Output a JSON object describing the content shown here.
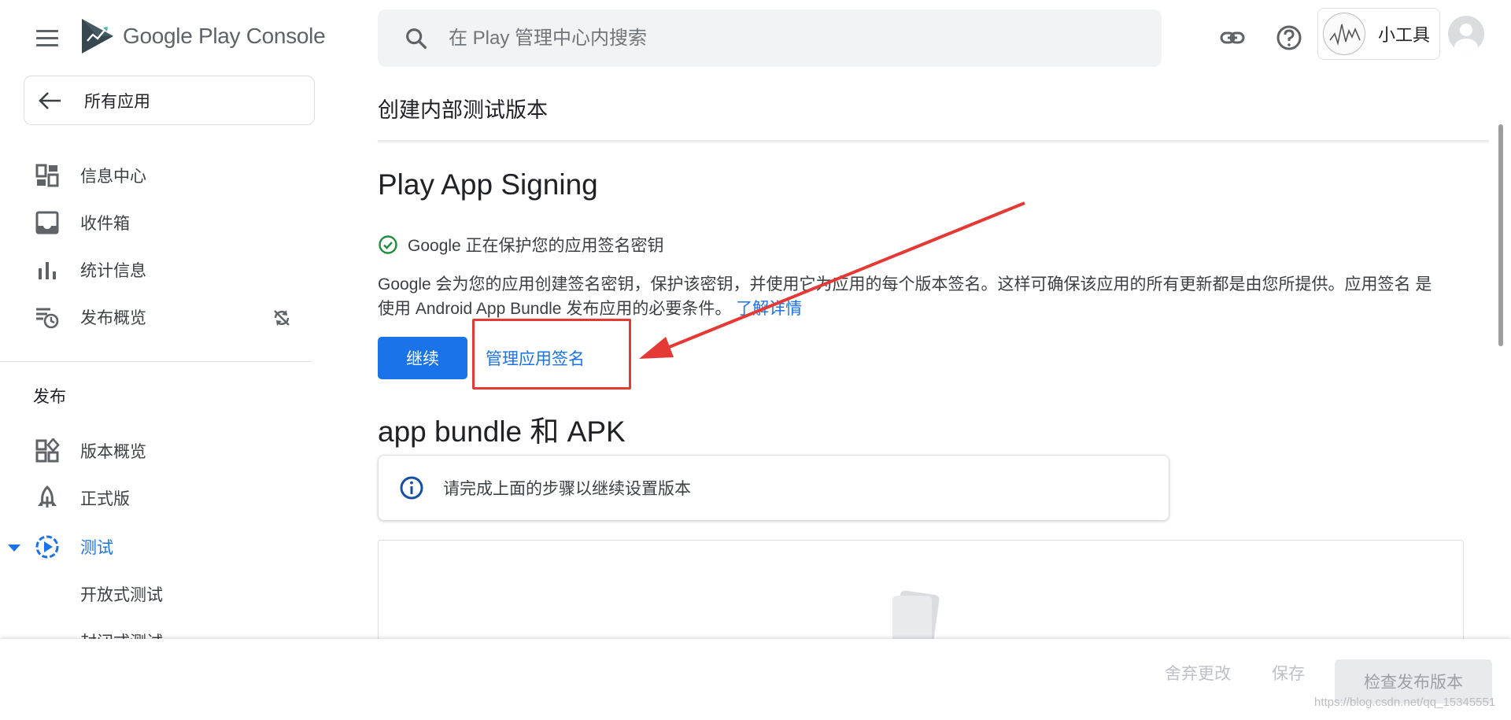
{
  "header": {
    "logo_text_1": "Google Play",
    "logo_text_2": "Console",
    "search_placeholder": "在 Play 管理中心内搜索",
    "account_name": "小工具"
  },
  "sidebar": {
    "back_label": "所有应用",
    "items_top": [
      {
        "label": "信息中心",
        "icon": "dashboard-icon"
      },
      {
        "label": "收件箱",
        "icon": "inbox-icon"
      },
      {
        "label": "统计信息",
        "icon": "bar-chart-icon"
      },
      {
        "label": "发布概览",
        "icon": "publishing-overview-icon"
      }
    ],
    "section_label": "发布",
    "items_release": [
      {
        "label": "版本概览",
        "icon": "release-overview-icon"
      },
      {
        "label": "正式版",
        "icon": "production-icon"
      },
      {
        "label": "测试",
        "icon": "testing-icon",
        "active": true
      }
    ],
    "sub_items": [
      "开放式测试",
      "封闭式测试"
    ]
  },
  "main": {
    "page_title": "创建内部测试版本",
    "signing_heading": "Play App Signing",
    "status_text": "Google 正在保护您的应用签名密钥",
    "description_1": "Google 会为您的应用创建签名密钥，保护该密钥，并使用它为应用的每个版本签名。这样可确保该应用的所有更新都是由您所提供。应用签名",
    "description_2": "是使用 Android App Bundle 发布应用的必要条件。",
    "learn_more": "了解详情",
    "continue_label": "继续",
    "manage_label": "管理应用签名",
    "bundle_heading": "app bundle 和 APK",
    "info_text": "请完成上面的步骤以继续设置版本"
  },
  "footer": {
    "discard_label": "舍弃更改",
    "save_label": "保存",
    "review_label": "检查发布版本",
    "watermark": "https://blog.csdn.net/qq_15345551"
  },
  "colors": {
    "accent": "#1a73e8",
    "success": "#1e8e3e",
    "annotation": "#e53935"
  }
}
